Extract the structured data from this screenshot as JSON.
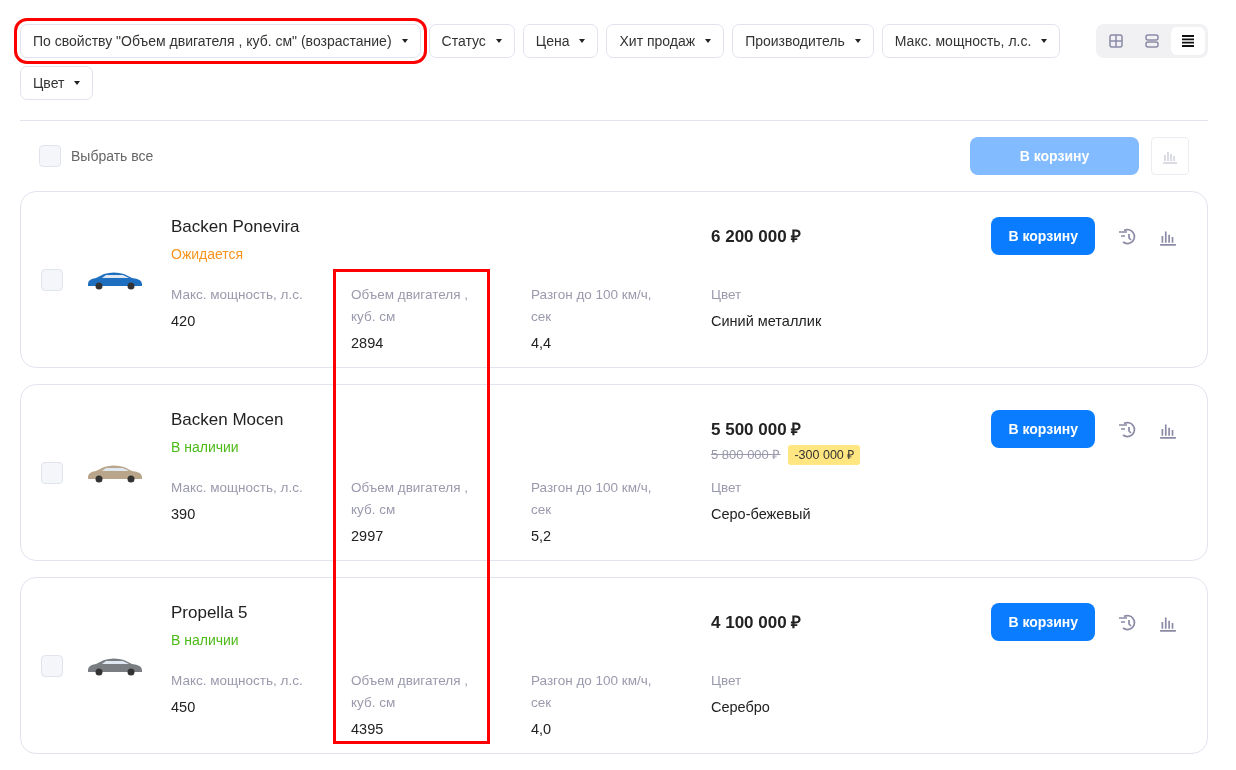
{
  "sort": {
    "label": "По свойству \"Объем двигателя , куб. см\" (возрастание)",
    "highlighted": true
  },
  "filters": [
    "Статус",
    "Цена",
    "Хит продаж",
    "Производитель",
    "Макс. мощность, л.с.",
    "Цвет"
  ],
  "views": [
    {
      "kind": "tiles",
      "selected": false
    },
    {
      "kind": "rows",
      "selected": false
    },
    {
      "kind": "list",
      "selected": true
    }
  ],
  "select_all": {
    "label": "Выбрать все",
    "checked": false
  },
  "bulk_cart": {
    "label": "В корзину",
    "disabled": true
  },
  "engine_column_highlighted": true,
  "products": [
    {
      "name": "Backen Ponevira",
      "status": "Ожидается",
      "kind": "waiting",
      "checked": false,
      "color": "#1f6fc0",
      "price": "6 200 000 ₽",
      "props": [
        {
          "label": "Макс. мощность, л.с.",
          "value": "420"
        },
        {
          "label": "Объем двигателя , куб. см",
          "value": "2894"
        },
        {
          "label": "Разгон до 100 км/ч, сек",
          "value": "4,4"
        },
        {
          "label": "Цвет",
          "value": "Синий металлик"
        }
      ],
      "cart": "В корзину"
    },
    {
      "name": "Backen Mocen",
      "status": "В наличии",
      "kind": "in_stock",
      "checked": false,
      "color": "#b8a58a",
      "price": "5 500 000 ₽",
      "old_price": "5 800 000 ₽",
      "discount": "-300 000 ₽",
      "props": [
        {
          "label": "Макс. мощность, л.с.",
          "value": "390"
        },
        {
          "label": "Объем двигателя , куб. см",
          "value": "2997"
        },
        {
          "label": "Разгон до 100 км/ч, сек",
          "value": "5,2"
        },
        {
          "label": "Цвет",
          "value": "Серо-бежевый"
        }
      ],
      "cart": "В корзину"
    },
    {
      "name": "Propella 5",
      "status": "В наличии",
      "kind": "in_stock",
      "checked": false,
      "color": "#7a7d82",
      "price": "4 100 000 ₽",
      "props": [
        {
          "label": "Макс. мощность, л.с.",
          "value": "450"
        },
        {
          "label": "Объем двигателя , куб. см",
          "value": "4395"
        },
        {
          "label": "Разгон до 100 км/ч, сек",
          "value": "4,0"
        },
        {
          "label": "Цвет",
          "value": "Серебро"
        }
      ],
      "cart": "В корзину"
    }
  ]
}
